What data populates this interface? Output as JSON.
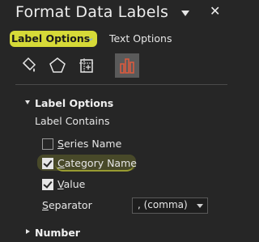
{
  "pane": {
    "title": "Format Data Labels",
    "close_glyph": "✕"
  },
  "tabs": [
    {
      "label": "Label Options",
      "selected": true
    },
    {
      "label": "Text Options",
      "selected": false
    }
  ],
  "icon_tabs": [
    {
      "icon": "paint-bucket-icon",
      "selected": false
    },
    {
      "icon": "pentagon-icon",
      "selected": false
    },
    {
      "icon": "size-properties-icon",
      "selected": false
    },
    {
      "icon": "bar-chart-icon",
      "selected": true
    }
  ],
  "label_options": {
    "section_title": "Label Options",
    "contains_label": "Label Contains",
    "checkboxes": [
      {
        "label": "Series Name",
        "access_key": "S",
        "rest": "eries Name",
        "checked": false
      },
      {
        "label": "Category Name",
        "access_key": "C",
        "rest": "ategory Name",
        "checked": true
      },
      {
        "label": "Value",
        "access_key": "V",
        "rest": "alue",
        "checked": true
      }
    ],
    "separator": {
      "label_key": "S",
      "label_rest": "eparator",
      "value": ", (comma)"
    }
  },
  "number_section": {
    "title": "Number",
    "expanded": false
  },
  "colors": {
    "background": "#262626",
    "highlight": "#e5ea3a",
    "selected_icon_bg": "#5a5a5a",
    "chart_icon": "#e05a3c"
  }
}
